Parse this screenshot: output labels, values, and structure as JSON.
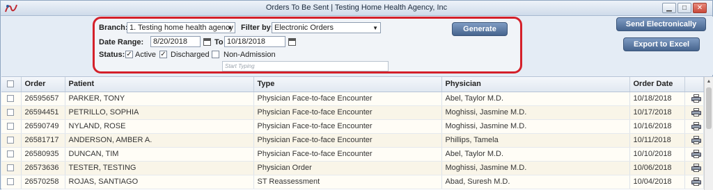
{
  "window": {
    "title": "Orders To Be Sent | Testing Home Health Agency, Inc"
  },
  "filters": {
    "branch_label": "Branch:",
    "branch_value": "1. Testing home health agency",
    "filterby_label": "Filter by:",
    "filterby_value": "Electronic Orders",
    "daterange_label": "Date Range:",
    "date_from": "8/20/2018",
    "to_label": "To",
    "date_to": "10/18/2018",
    "status_label": "Status:",
    "statuses": [
      {
        "label": "Active",
        "checked": true
      },
      {
        "label": "Discharged",
        "checked": true
      },
      {
        "label": "Non-Admission",
        "checked": false
      }
    ],
    "search_placeholder": "Start Typing"
  },
  "buttons": {
    "generate": "Generate",
    "send_electronically": "Send Electronically",
    "export_excel": "Export to Excel"
  },
  "table": {
    "columns": [
      "Order",
      "Patient",
      "Type",
      "Physician",
      "Order Date"
    ],
    "rows": [
      {
        "order": "26595657",
        "patient": "PARKER, TONY",
        "type": "Physician Face-to-face Encounter",
        "physician": "Abel, Taylor M.D.",
        "date": "10/18/2018"
      },
      {
        "order": "26594451",
        "patient": "PETRILLO, SOPHIA",
        "type": "Physician Face-to-face Encounter",
        "physician": "Moghissi, Jasmine M.D.",
        "date": "10/17/2018"
      },
      {
        "order": "26590749",
        "patient": "NYLAND, ROSE",
        "type": "Physician Face-to-face Encounter",
        "physician": "Moghissi, Jasmine M.D.",
        "date": "10/16/2018"
      },
      {
        "order": "26581717",
        "patient": "ANDERSON, AMBER A.",
        "type": "Physician Face-to-face Encounter",
        "physician": "Phillips, Tamela",
        "date": "10/11/2018"
      },
      {
        "order": "26580935",
        "patient": "DUNCAN, TIM",
        "type": "Physician Face-to-face Encounter",
        "physician": "Abel, Taylor M.D.",
        "date": "10/10/2018"
      },
      {
        "order": "26573636",
        "patient": "TESTER, TESTING",
        "type": "Physician Order",
        "physician": "Moghissi, Jasmine M.D.",
        "date": "10/06/2018"
      },
      {
        "order": "26570258",
        "patient": "ROJAS, SANTIAGO",
        "type": "ST Reassessment",
        "physician": "Abad, Suresh M.D.",
        "date": "10/04/2018"
      }
    ]
  },
  "colors": {
    "accent_red": "#d4202a",
    "button_blue": "#46648e"
  }
}
